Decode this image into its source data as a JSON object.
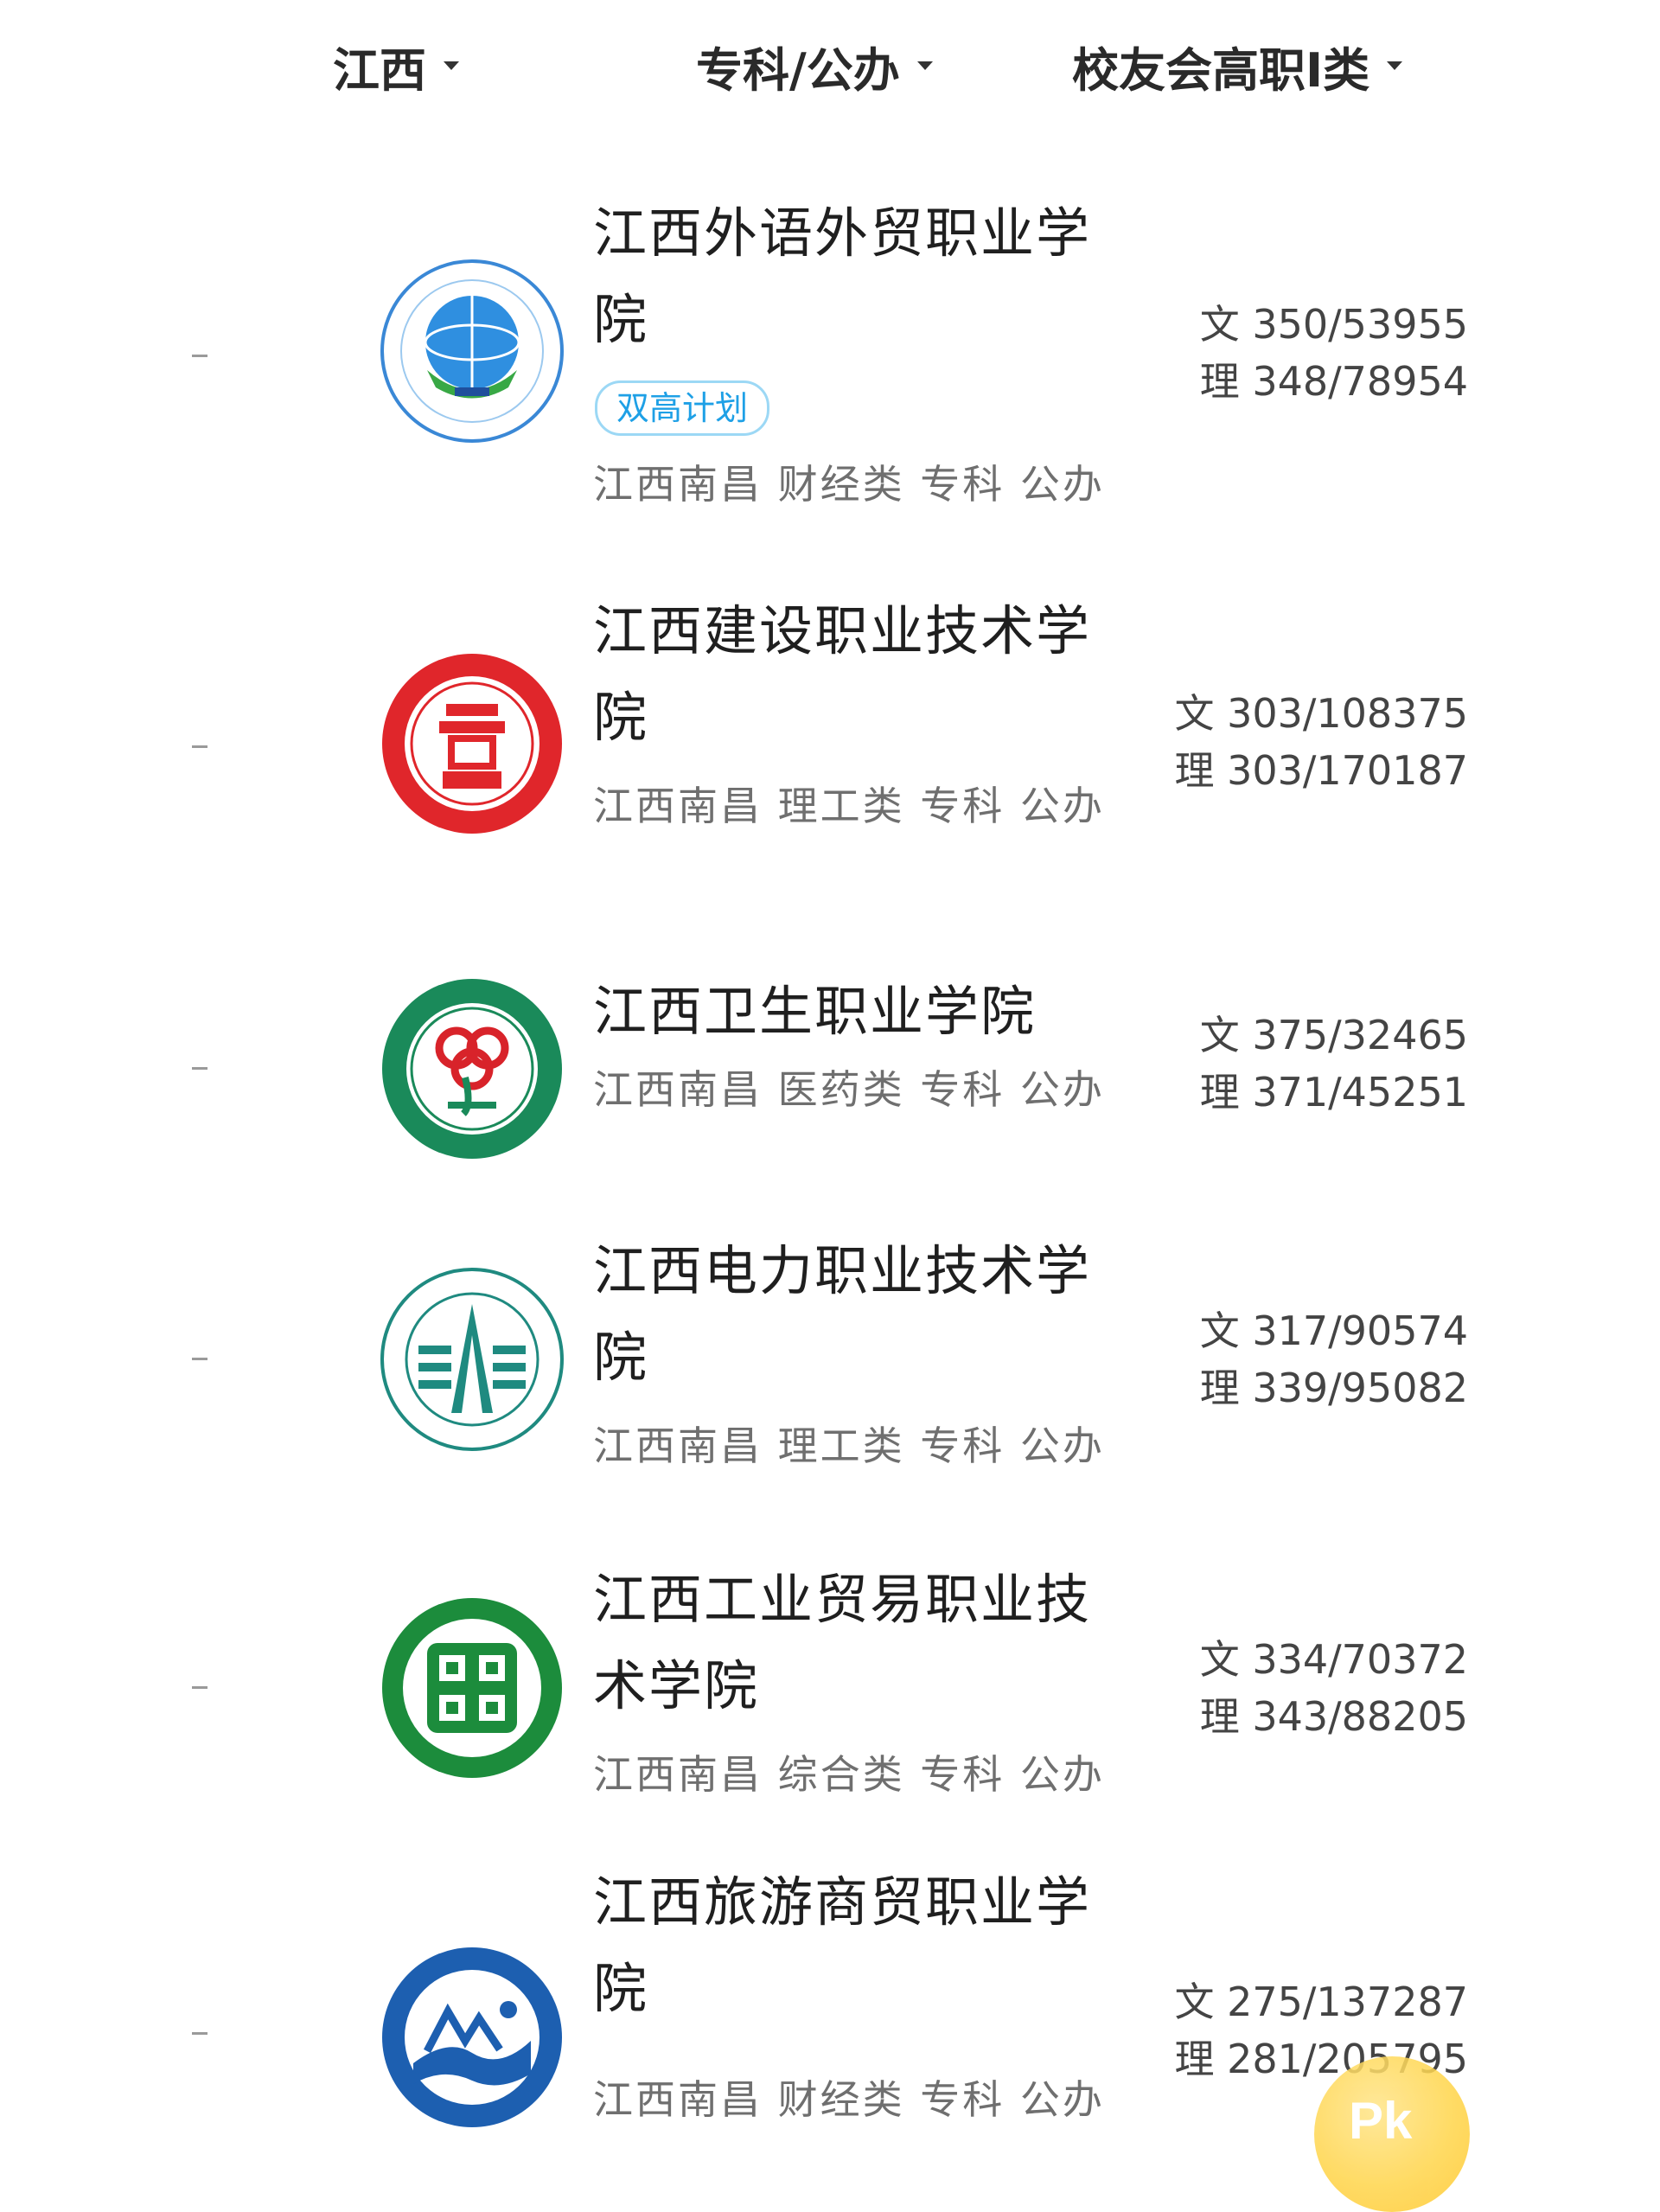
{
  "filters": {
    "province": "江西",
    "school_type": "专科/公办",
    "ranking": "校友会高职I类"
  },
  "schools": [
    {
      "name": "江西外语外贸职业学院",
      "tag": "双高计划",
      "meta": "江西南昌 财经类 专科 公办",
      "score_wen": "文 350/53955",
      "score_li": "理 348/78954",
      "logo_icon": "jiangxi-foreign-trade-emblem-icon",
      "logo_color": "#2e7fd0"
    },
    {
      "name": "江西建设职业技术学院",
      "tag": "",
      "meta": "江西南昌 理工类 专科 公办",
      "score_wen": "文 303/108375",
      "score_li": "理 303/170187",
      "logo_icon": "jiangxi-construction-emblem-icon",
      "logo_color": "#e0262b"
    },
    {
      "name": "江西卫生职业学院",
      "tag": "",
      "meta": "江西南昌 医药类 专科 公办",
      "score_wen": "文 375/32465",
      "score_li": "理 371/45251",
      "logo_icon": "jiangxi-health-emblem-icon",
      "logo_color": "#1a8a5a"
    },
    {
      "name": "江西电力职业技术学院",
      "tag": "",
      "meta": "江西南昌 理工类 专科 公办",
      "score_wen": "文 317/90574",
      "score_li": "理 339/95082",
      "logo_icon": "jiangxi-electric-emblem-icon",
      "logo_color": "#1f8a80"
    },
    {
      "name": "江西工业贸易职业技术学院",
      "tag": "",
      "meta": "江西南昌 综合类 专科 公办",
      "score_wen": "文 334/70372",
      "score_li": "理 343/88205",
      "logo_icon": "jiangxi-industry-trade-emblem-icon",
      "logo_color": "#1c8c3c"
    },
    {
      "name": "江西旅游商贸职业学院",
      "tag": "",
      "meta": "江西南昌 财经类 专科 公办",
      "score_wen": "文 275/137287",
      "score_li": "理 281/205795",
      "logo_icon": "jiangxi-tourism-emblem-icon",
      "logo_color": "#1d5fb0"
    }
  ],
  "pk_button": {
    "label": "Pk"
  }
}
